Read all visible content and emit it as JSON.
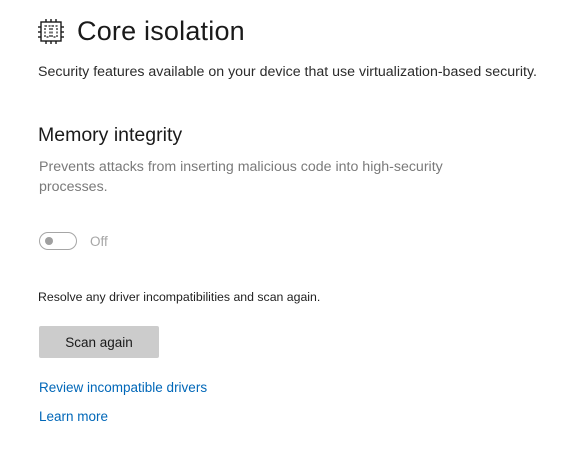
{
  "header": {
    "icon": "core-isolation-icon",
    "title": "Core isolation"
  },
  "description": "Security features available on your device that use virtualization-based security.",
  "memory_integrity": {
    "title": "Memory integrity",
    "description": "Prevents attacks from inserting malicious code into high-security processes.",
    "toggle": {
      "state": "off",
      "label": "Off",
      "enabled": false
    }
  },
  "resolve_text": "Resolve any driver incompatibilities and scan again.",
  "scan_button_label": "Scan again",
  "links": {
    "review_drivers": "Review incompatible drivers",
    "learn_more": "Learn more"
  },
  "colors": {
    "link": "#0067b8",
    "button_bg": "#cccccc",
    "disabled_text": "#a6a6a6"
  }
}
